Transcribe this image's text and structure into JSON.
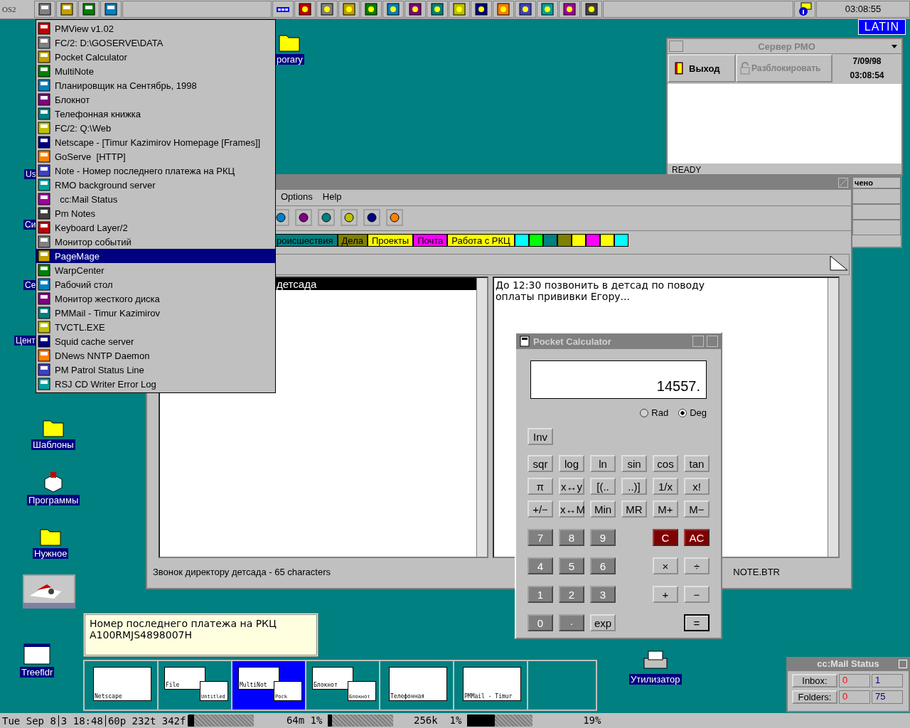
{
  "taskbar": {
    "logo": "OS2",
    "clock": "03:08:55"
  },
  "keyboard_layout": "LATIN",
  "desktop_icons": [
    {
      "label": "porary",
      "kind": "folder"
    },
    {
      "label": "Us",
      "kind": "cut"
    },
    {
      "label": "Си",
      "kind": "cut"
    },
    {
      "label": "Се",
      "kind": "cut"
    },
    {
      "label": "Цент",
      "kind": "cut"
    },
    {
      "label": "Шаблоны",
      "kind": "folder"
    },
    {
      "label": "Программы",
      "kind": "box"
    },
    {
      "label": "Нужное",
      "kind": "folder"
    },
    {
      "kind": "picture"
    },
    {
      "label": "Treefldr",
      "kind": "window"
    },
    {
      "label": "Утилизатор",
      "kind": "printer"
    }
  ],
  "menu": {
    "items": [
      {
        "label": "PMView v1.02",
        "selected": false
      },
      {
        "label": "FC/2: D:\\GOSERVE\\DATA",
        "selected": false
      },
      {
        "label": "Pocket Calculator",
        "selected": false
      },
      {
        "label": "MultiNote",
        "selected": false
      },
      {
        "label": "Планировщик на Сентябрь, 1998",
        "selected": false
      },
      {
        "label": "Блокнот",
        "selected": false
      },
      {
        "label": "Телефонная книжка",
        "selected": false
      },
      {
        "label": "FC/2: Q:\\Web",
        "selected": false
      },
      {
        "label": "Netscape - [Timur Kazimirov Homepage [Frames]]",
        "selected": false
      },
      {
        "label": "GoServe  [HTTP]",
        "selected": false
      },
      {
        "label": "Note - Номер последнего платежа на РКЦ",
        "selected": false
      },
      {
        "label": "RMO background server",
        "selected": false
      },
      {
        "label": "  cc:Mail Status",
        "selected": false
      },
      {
        "label": "Pm Notes",
        "selected": false
      },
      {
        "label": "Keyboard Layer/2",
        "selected": false
      },
      {
        "label": "Монитор событий",
        "selected": false
      },
      {
        "label": "PageMage",
        "selected": true
      },
      {
        "label": "WarpCenter",
        "selected": false
      },
      {
        "label": "Рабочий стол",
        "selected": false
      },
      {
        "label": "Монитор жесткого диска",
        "selected": false
      },
      {
        "label": "PMMail - Timur Kazimirov",
        "selected": false
      },
      {
        "label": "TVCTL.EXE",
        "selected": false
      },
      {
        "label": "Squid cache server",
        "selected": false
      },
      {
        "label": "DNews NNTP Daemon",
        "selected": false
      },
      {
        "label": "PM Patrol Status Line",
        "selected": false
      },
      {
        "label": "RSJ CD Writer Error Log",
        "selected": false
      }
    ]
  },
  "server_window": {
    "title": "Сервер РМО",
    "buttons": [
      {
        "label": "Выход",
        "disabled": false
      },
      {
        "label": "Разблокировать",
        "disabled": true
      }
    ],
    "date": "7/09/98",
    "time": "03:08:54",
    "status": "READY",
    "column": "чено"
  },
  "notes_window": {
    "menu": [
      "Options",
      "Help"
    ],
    "tabs": [
      {
        "label": "роисшествия",
        "color": "#008080"
      },
      {
        "label": "Дела",
        "color": "#808000"
      },
      {
        "label": "Проекты",
        "color": "#ffff00"
      },
      {
        "label": "Почта",
        "color": "#ff00ff"
      },
      {
        "label": "Работа с РКЦ",
        "color": "#ffff00"
      },
      {
        "color": "#00ffff"
      },
      {
        "color": "#00ff00"
      },
      {
        "color": "#008080"
      },
      {
        "color": "#808000"
      },
      {
        "color": "#ffff00"
      },
      {
        "color": "#ff00ff"
      },
      {
        "color": "#ffff00"
      },
      {
        "color": "#00ffff"
      }
    ],
    "list": [
      {
        "label": "детсада",
        "selected": true
      }
    ],
    "text": "До 12:30 позвонить в детсад по поводу\nоплаты прививки Егору...",
    "status": "Звонок директору детсада - 65 characters",
    "file": "NOTE.BTR"
  },
  "calculator": {
    "title": "Pocket Calculator",
    "display": "14557.",
    "modes": [
      {
        "label": "Rad",
        "selected": false
      },
      {
        "label": "Deg",
        "selected": true
      }
    ],
    "rows": [
      [
        {
          "label": "Inv",
          "kind": "light"
        }
      ],
      [
        {
          "label": "sqr",
          "kind": "light"
        },
        {
          "label": "log",
          "kind": "light"
        },
        {
          "label": "ln",
          "kind": "light"
        },
        {
          "label": "sin",
          "kind": "light"
        },
        {
          "label": "cos",
          "kind": "light"
        },
        {
          "label": "tan",
          "kind": "light"
        }
      ],
      [
        {
          "label": "π",
          "kind": "light"
        },
        {
          "label": "x↔y",
          "kind": "light"
        },
        {
          "label": "[(..",
          "kind": "light"
        },
        {
          "label": "..)]",
          "kind": "light"
        },
        {
          "label": "1/x",
          "kind": "light"
        },
        {
          "label": "x!",
          "kind": "light"
        }
      ],
      [
        {
          "label": "+/−",
          "kind": "light"
        },
        {
          "label": "x↔M",
          "kind": "light"
        },
        {
          "label": "Min",
          "kind": "light"
        },
        {
          "label": "MR",
          "kind": "light"
        },
        {
          "label": "M+",
          "kind": "light"
        },
        {
          "label": "M−",
          "kind": "light"
        }
      ],
      [
        {
          "label": "7",
          "kind": "dark"
        },
        {
          "label": "8",
          "kind": "dark"
        },
        {
          "label": "9",
          "kind": "dark"
        },
        {
          "kind": "spacer"
        },
        {
          "label": "C",
          "kind": "red"
        },
        {
          "label": "AC",
          "kind": "red"
        }
      ],
      [
        {
          "label": "4",
          "kind": "dark"
        },
        {
          "label": "5",
          "kind": "dark"
        },
        {
          "label": "6",
          "kind": "dark"
        },
        {
          "kind": "spacer"
        },
        {
          "label": "×",
          "kind": "light"
        },
        {
          "label": "÷",
          "kind": "light"
        }
      ],
      [
        {
          "label": "1",
          "kind": "dark"
        },
        {
          "label": "2",
          "kind": "dark"
        },
        {
          "label": "3",
          "kind": "dark"
        },
        {
          "kind": "spacer"
        },
        {
          "label": "+",
          "kind": "light"
        },
        {
          "label": "−",
          "kind": "light"
        }
      ],
      [
        {
          "label": "0",
          "kind": "dark"
        },
        {
          "label": "·",
          "kind": "dark"
        },
        {
          "label": "exp",
          "kind": "light"
        },
        {
          "kind": "spacer"
        },
        {
          "kind": "spacer"
        },
        {
          "label": "=",
          "kind": "default"
        }
      ]
    ]
  },
  "note_popup": {
    "lines": [
      "Номер последнего платежа на РКЦ",
      "A100RMJS4898007H"
    ]
  },
  "window_list": [
    {
      "labels": [
        "Netscape"
      ],
      "selected": false
    },
    {
      "labels": [
        "File",
        "Untitled"
      ],
      "selected": false
    },
    {
      "labels": [
        "MultiNot",
        "Pock"
      ],
      "selected": true
    },
    {
      "labels": [
        "Блокнот",
        "Блокнот"
      ],
      "selected": false
    },
    {
      "labels": [
        "Телефонная"
      ],
      "selected": false
    },
    {
      "labels": [
        "PMMail - Timur"
      ],
      "selected": false
    }
  ],
  "ccmail": {
    "title": "cc:Mail Status",
    "rows": [
      {
        "label": "Inbox:",
        "unread": "0",
        "total": "1"
      },
      {
        "label": "Folders:",
        "unread": "0",
        "total": "75"
      }
    ]
  },
  "status_line": {
    "date": "Tue Sep 8",
    "time": "3 18:48",
    "procs": "60p 232t 342f",
    "meters": [
      {
        "reading": "64m 1%",
        "level": 0.03
      },
      {
        "reading": "256k  1%",
        "level": 0.02
      },
      {
        "reading": "19%",
        "level": 0.19
      }
    ]
  }
}
